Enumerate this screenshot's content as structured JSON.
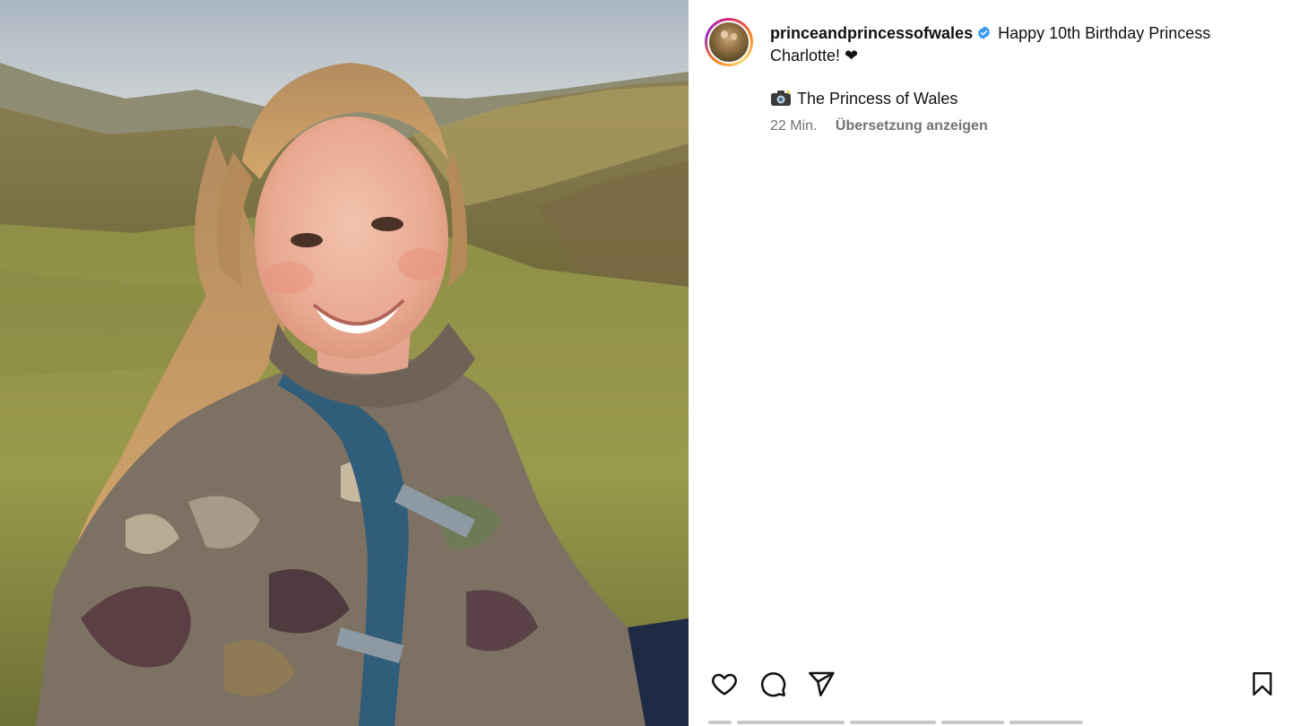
{
  "post": {
    "username": "princeandprincessofwales",
    "verified": true,
    "caption_text": "Happy 10th Birthday Princess Charlotte! ❤",
    "credit": "The Princess of Wales",
    "time": "22 Min.",
    "translate_label": "Übersetzung anzeigen"
  },
  "photo": {
    "description_icon": "photo-of-smiling-girl-in-camouflage-jacket-on-hillside"
  },
  "icons": {
    "verified": "verified-badge-icon",
    "camera": "camera-flash-icon",
    "like": "heart-icon",
    "comment": "comment-bubble-icon",
    "share": "paper-plane-icon",
    "save": "bookmark-icon"
  },
  "colors": {
    "verified_blue": "#3897f0",
    "text": "#111111",
    "secondary_text": "#737373",
    "story_ring": [
      "#d62976",
      "#fa7e1e",
      "#feda75",
      "#962fbf"
    ]
  }
}
